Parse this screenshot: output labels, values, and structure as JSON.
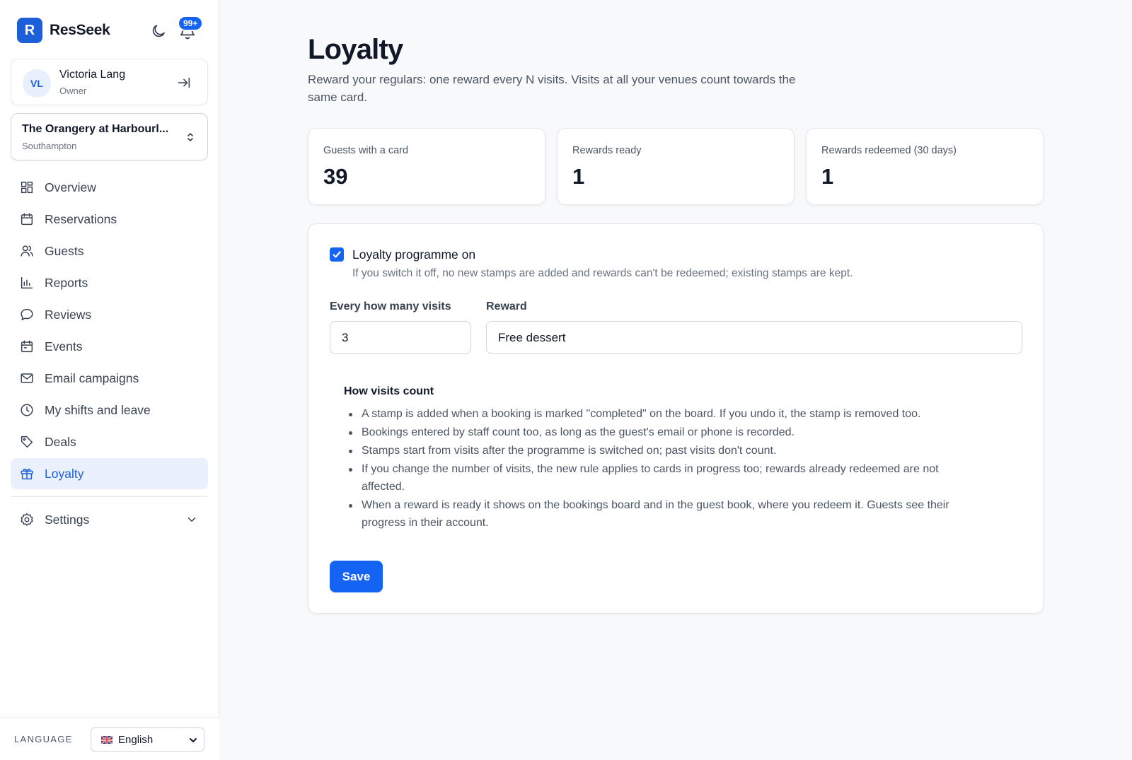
{
  "app": {
    "name": "ResSeek",
    "logo_letter": "R",
    "notifications_badge": "99+"
  },
  "user": {
    "initials": "VL",
    "name": "Victoria Lang",
    "role": "Owner"
  },
  "venue": {
    "name": "The Orangery at Harbourl...",
    "city": "Southampton"
  },
  "nav": {
    "items": [
      {
        "label": "Overview",
        "icon": "grid-icon"
      },
      {
        "label": "Reservations",
        "icon": "calendar-icon"
      },
      {
        "label": "Guests",
        "icon": "users-icon"
      },
      {
        "label": "Reports",
        "icon": "bar-chart-icon"
      },
      {
        "label": "Reviews",
        "icon": "message-icon"
      },
      {
        "label": "Events",
        "icon": "calendar-event-icon"
      },
      {
        "label": "Email campaigns",
        "icon": "mail-icon"
      },
      {
        "label": "My shifts and leave",
        "icon": "clock-icon"
      },
      {
        "label": "Deals",
        "icon": "tag-icon"
      },
      {
        "label": "Loyalty",
        "icon": "gift-icon",
        "active": true
      }
    ],
    "settings_label": "Settings"
  },
  "language": {
    "label": "LANGUAGE",
    "selected": "English"
  },
  "page": {
    "title": "Loyalty",
    "description": "Reward your regulars: one reward every N visits. Visits at all your venues count towards the same card."
  },
  "stats": [
    {
      "label": "Guests with a card",
      "value": "39"
    },
    {
      "label": "Rewards ready",
      "value": "1"
    },
    {
      "label": "Rewards redeemed (30 days)",
      "value": "1"
    }
  ],
  "settings_form": {
    "toggle_label": "Loyalty programme on",
    "toggle_checked": true,
    "toggle_help": "If you switch it off, no new stamps are added and rewards can't be redeemed; existing stamps are kept.",
    "visits_label": "Every how many visits",
    "visits_value": "3",
    "reward_label": "Reward",
    "reward_value": "Free dessert",
    "howto_title": "How visits count",
    "howto_items": [
      "A stamp is added when a booking is marked \"completed\" on the board. If you undo it, the stamp is removed too.",
      "Bookings entered by staff count too, as long as the guest's email or phone is recorded.",
      "Stamps start from visits after the programme is switched on; past visits don't count.",
      "If you change the number of visits, the new rule applies to cards in progress too; rewards already redeemed are not affected.",
      "When a reward is ready it shows on the bookings board and in the guest book, where you redeem it. Guests see their progress in their account."
    ],
    "save_label": "Save"
  },
  "colors": {
    "accent": "#1463f3",
    "active_bg": "#eaf1fd",
    "active_text": "#1d5fd8"
  }
}
